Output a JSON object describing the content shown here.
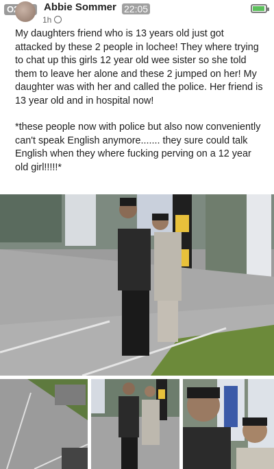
{
  "status_bar": {
    "carrier": "O2-UK",
    "time": "22:05"
  },
  "post": {
    "author": "Abbie Sommer",
    "timestamp": "1h",
    "paragraphs": [
      "My daughters friend who is 13 years old just got attacked by these 2 people in lochee! They where trying to chat up this girls 12 year old wee sister so she told them to leave her alone and these 2 jumped on her! My daughter was with her and called the police. Her friend is 13 year old and in hospital now!",
      "*these people now with police but also now conveniently can't speak English anymore....... they sure could talk English when they where fucking perving on a 12 year old girl!!!!!*"
    ]
  },
  "icons": {
    "signal": "signal-icon",
    "wifi": "wifi-icon",
    "battery": "battery-icon",
    "privacy": "globe-icon"
  },
  "colors": {
    "battery_fill": "#5cc05c"
  }
}
